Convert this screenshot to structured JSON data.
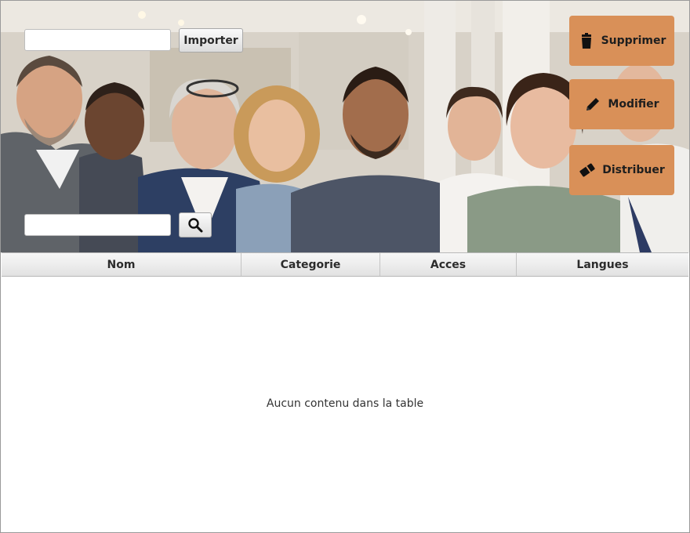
{
  "header": {
    "import_input": {
      "value": "",
      "placeholder": ""
    },
    "import_label": "Importer",
    "search_input": {
      "value": "",
      "placeholder": ""
    },
    "search_icon": "magnifier-icon"
  },
  "actions": {
    "delete_label": "Supprimer",
    "delete_icon": "trash-icon",
    "edit_label": "Modifier",
    "edit_icon": "pencil-icon",
    "distribute_label": "Distribuer",
    "distribute_icon": "eraser-icon",
    "accent_color": "#d99058"
  },
  "table": {
    "columns": [
      "Nom",
      "Categorie",
      "Acces",
      "Langues"
    ],
    "rows": [],
    "empty_message": "Aucun contenu dans la table"
  }
}
